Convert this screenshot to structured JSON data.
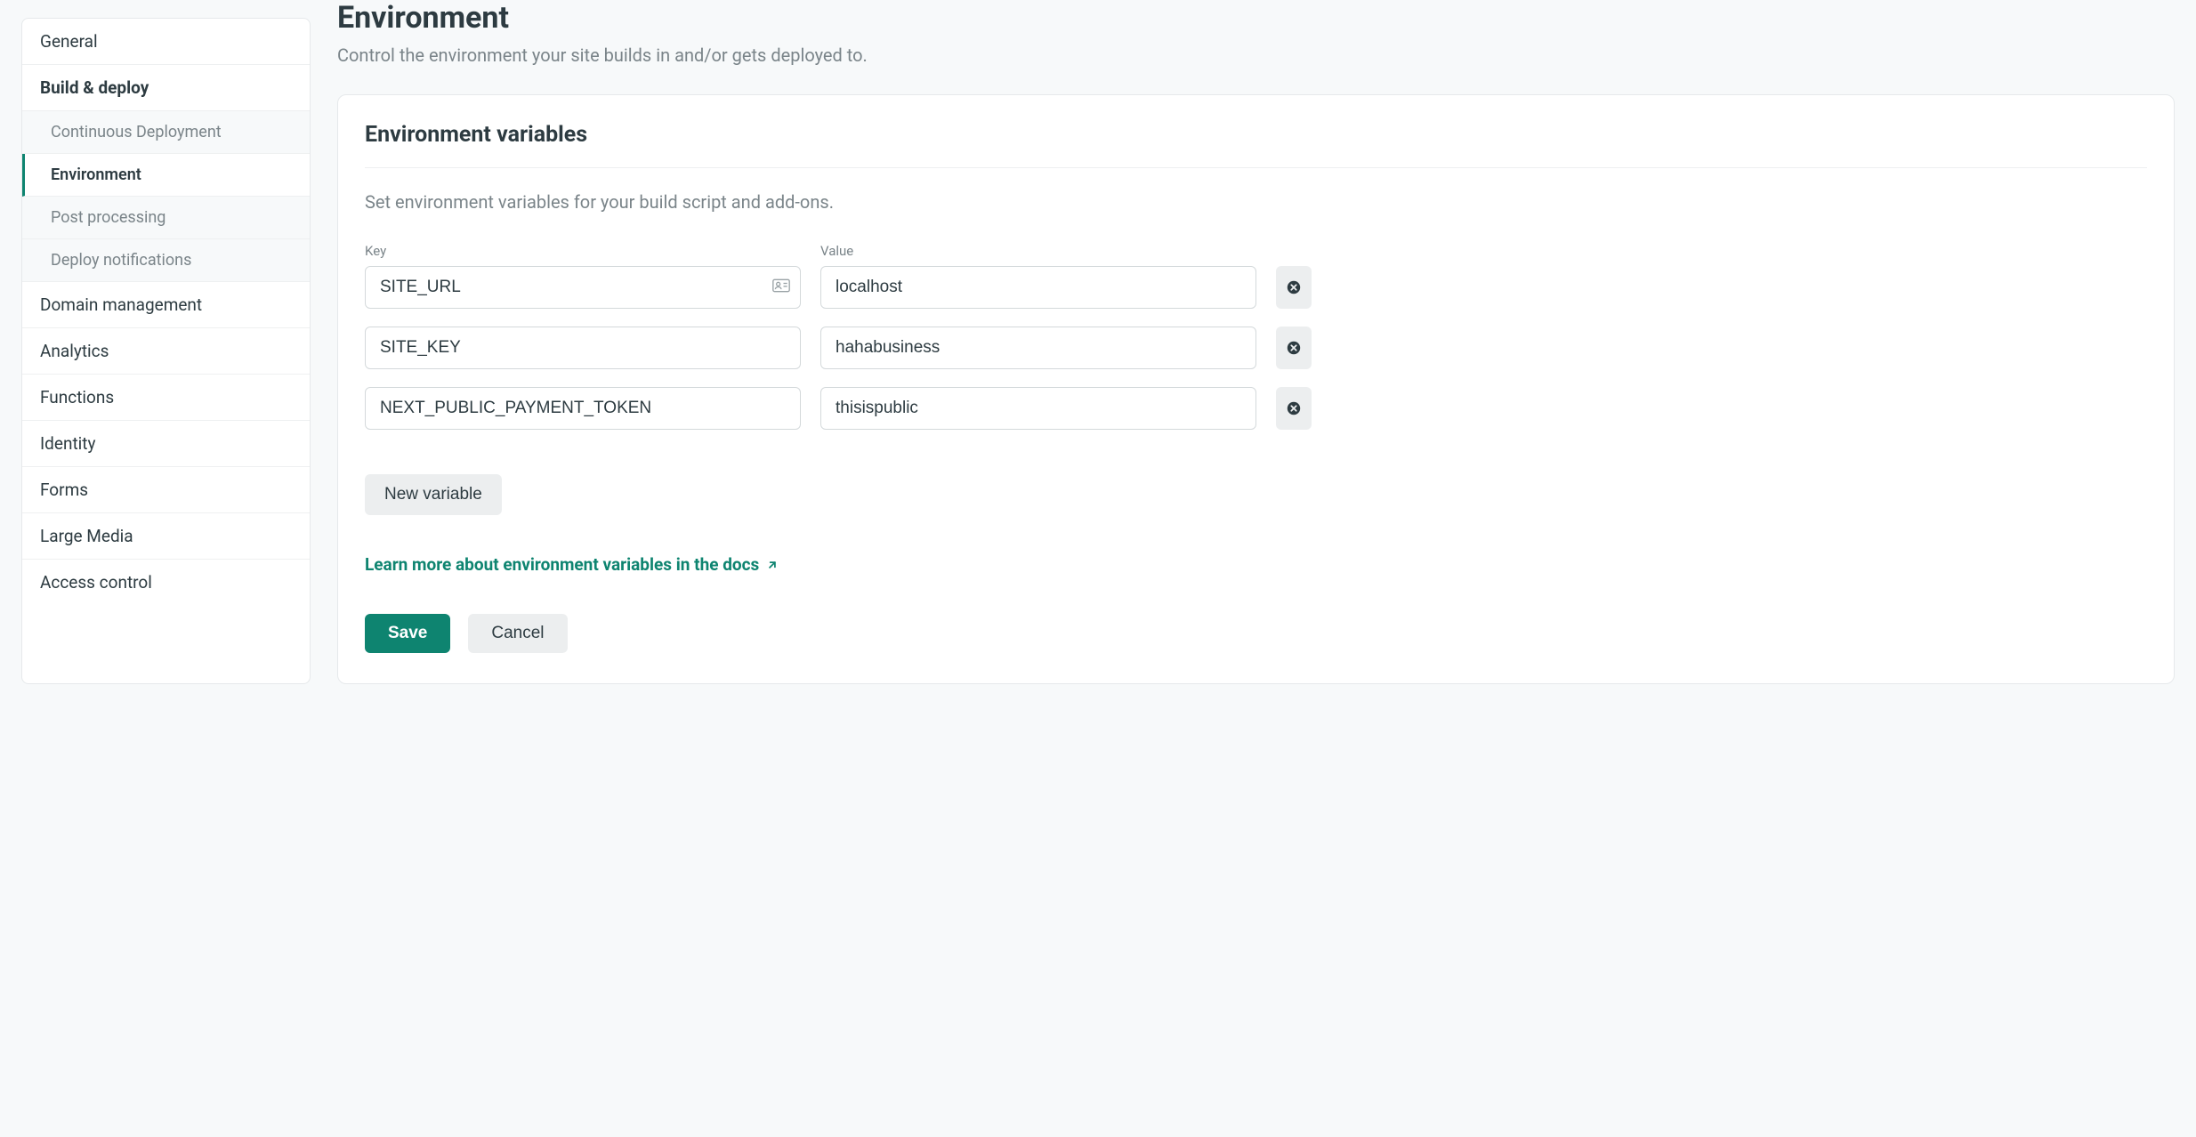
{
  "sidebar": {
    "items": [
      {
        "label": "General"
      },
      {
        "label": "Build & deploy"
      },
      {
        "label": "Domain management"
      },
      {
        "label": "Analytics"
      },
      {
        "label": "Functions"
      },
      {
        "label": "Identity"
      },
      {
        "label": "Forms"
      },
      {
        "label": "Large Media"
      },
      {
        "label": "Access control"
      }
    ],
    "subitems": [
      {
        "label": "Continuous Deployment"
      },
      {
        "label": "Environment"
      },
      {
        "label": "Post processing"
      },
      {
        "label": "Deploy notifications"
      }
    ]
  },
  "page": {
    "title": "Environment",
    "subtitle": "Control the environment your site builds in and/or gets deployed to."
  },
  "card": {
    "title": "Environment variables",
    "desc": "Set environment variables for your build script and add-ons.",
    "key_label": "Key",
    "value_label": "Value",
    "vars": [
      {
        "key": "SITE_URL",
        "value": "localhost",
        "showAutofill": true
      },
      {
        "key": "SITE_KEY",
        "value": "hahabusiness",
        "showAutofill": false
      },
      {
        "key": "NEXT_PUBLIC_PAYMENT_TOKEN",
        "value": "thisispublic",
        "showAutofill": false
      }
    ],
    "new_var_label": "New variable",
    "docs_link": "Learn more about environment variables in the docs",
    "save_label": "Save",
    "cancel_label": "Cancel"
  }
}
